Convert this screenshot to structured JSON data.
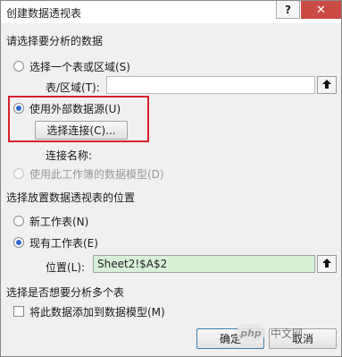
{
  "window": {
    "title": "创建数据透视表",
    "help_label": "?",
    "close_label": "✕"
  },
  "section_analyze": {
    "title": "请选择要分析的数据",
    "option_range_label": "选择一个表或区域(S)",
    "table_range_label": "表/区域(T):",
    "table_range_value": "",
    "option_external_label": "使用外部数据源(U)",
    "choose_connection_label": "选择连接(C)...",
    "connection_name_label": "连接名称:",
    "option_model_label": "使用此工作簿的数据模型(D)",
    "selected": "external"
  },
  "section_location": {
    "title": "选择放置数据透视表的位置",
    "option_new_label": "新工作表(N)",
    "option_existing_label": "现有工作表(E)",
    "location_label": "位置(L):",
    "location_value": "Sheet2!$A$2",
    "selected": "existing"
  },
  "section_multi": {
    "title": "选择是否想要分析多个表",
    "add_to_model_label": "将此数据添加到数据模型(M)",
    "add_to_model_checked": false
  },
  "footer": {
    "ok_label": "确定",
    "cancel_label": "取消"
  },
  "watermark": {
    "logo_text": "php",
    "text": "中文网"
  },
  "icons": {
    "range_picker": "range-select-icon"
  }
}
